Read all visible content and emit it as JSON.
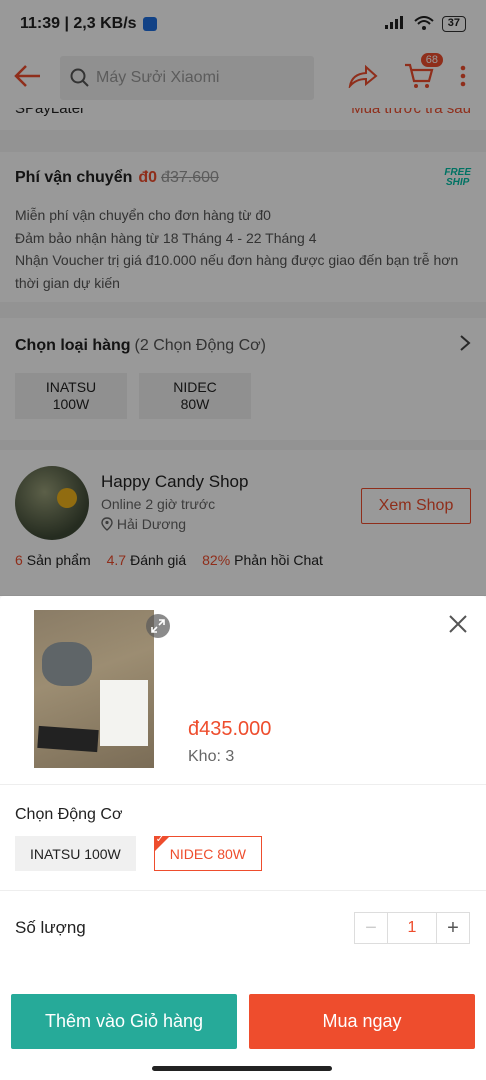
{
  "status_bar": {
    "time_speed": "11:39 | 2,3 KB/s",
    "battery": "37"
  },
  "header": {
    "search_placeholder": "Máy Sưởi Xiaomi",
    "cart_count": "68"
  },
  "spay": {
    "label": "SPayLater",
    "right": "Mua trước trả sau"
  },
  "shipping": {
    "title": "Phí vận chuyển",
    "price": "đ0",
    "old_price": "đ37.600",
    "freeship_top": "FREE",
    "freeship_bottom": "SHIP",
    "lines": [
      "Miễn phí vận chuyển cho đơn hàng từ đ0",
      "Đảm bảo nhận hàng từ 18 Tháng 4 - 22 Tháng 4",
      "Nhận Voucher trị giá đ10.000 nếu đơn hàng được giao đến bạn trễ hơn",
      "thời gian dự kiến"
    ]
  },
  "variant": {
    "title": "Chọn loại hàng",
    "sub": "(2 Chọn Động Cơ)",
    "options": [
      {
        "line1": "INATSU",
        "line2": "100W"
      },
      {
        "line1": "NIDEC",
        "line2": "80W"
      }
    ]
  },
  "shop": {
    "name": "Happy Candy Shop",
    "online": "Online 2 giờ trước",
    "location": "Hải Dương",
    "button": "Xem Shop",
    "stats": [
      {
        "num": "6",
        "label": "Sản phẩm"
      },
      {
        "num": "4.7",
        "label": "Đánh giá"
      },
      {
        "num": "82%",
        "label": "Phản hồi Chat"
      }
    ]
  },
  "sheet": {
    "price": "đ435.000",
    "stock": "Kho: 3",
    "option_label": "Chọn Động Cơ",
    "options": [
      "INATSU 100W",
      "NIDEC 80W"
    ],
    "quantity_label": "Số lượng",
    "quantity_value": "1",
    "add_to_cart": "Thêm vào Giỏ hàng",
    "buy_now": "Mua ngay"
  }
}
